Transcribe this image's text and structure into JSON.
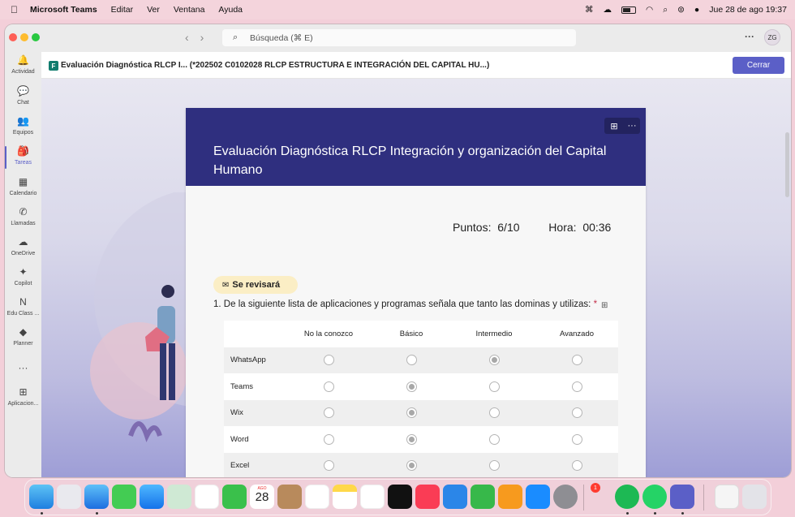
{
  "menubar": {
    "app_name": "Microsoft Teams",
    "menus": [
      "Editar",
      "Ver",
      "Ventana",
      "Ayuda"
    ],
    "datetime": "Jue 28 de ago  19:37"
  },
  "titlebar": {
    "search_placeholder": "Búsqueda (⌘ E)",
    "more": "···",
    "avatar_initials": "ZG"
  },
  "rail": {
    "items": [
      {
        "label": "Actividad",
        "icon": "bell-icon",
        "glyph": "🔔"
      },
      {
        "label": "Chat",
        "icon": "chat-icon",
        "glyph": "💬"
      },
      {
        "label": "Equipos",
        "icon": "teams-icon",
        "glyph": "👥"
      },
      {
        "label": "Tareas",
        "icon": "tasks-icon",
        "glyph": "🎒"
      },
      {
        "label": "Calendario",
        "icon": "calendar-icon",
        "glyph": "▦"
      },
      {
        "label": "Llamadas",
        "icon": "phone-icon",
        "glyph": "✆"
      },
      {
        "label": "OneDrive",
        "icon": "cloud-icon",
        "glyph": "☁"
      },
      {
        "label": "Copilot",
        "icon": "copilot-icon",
        "glyph": "✦"
      },
      {
        "label": "Edu Class ...",
        "icon": "notebook-icon",
        "glyph": "N"
      },
      {
        "label": "Planner",
        "icon": "planner-icon",
        "glyph": "◆"
      },
      {
        "label": "",
        "icon": "more-icon",
        "glyph": "···"
      },
      {
        "label": "Aplicacion...",
        "icon": "add-apps-icon",
        "glyph": "⊞"
      }
    ],
    "active_index": 3
  },
  "header": {
    "file_icon": "excel-forms-icon",
    "title": "Evaluación Diagnóstica RLCP  I... (*202502 C0102028 RLCP ESTRUCTURA E INTEGRACIÓN DEL CAPITAL HU...)",
    "close_label": "Cerrar"
  },
  "form": {
    "title": "Evaluación Diagnóstica RLCP  Integración y organización del Capital Humano",
    "points_label": "Puntos:",
    "points_value": "6/10",
    "time_label": "Hora:",
    "time_value": "00:36",
    "review_badge": "Se revisará",
    "question_number": "1.",
    "question_text": "De la siguiente lista de aplicaciones y programas señala que tanto las dominas y utilizas:",
    "required_mark": "*",
    "columns": [
      "No la conozco",
      "Básico",
      "Intermedio",
      "Avanzado"
    ],
    "rows": [
      {
        "label": "WhatsApp",
        "selected": 2
      },
      {
        "label": "Teams",
        "selected": 1
      },
      {
        "label": "Wix",
        "selected": 1
      },
      {
        "label": "Word",
        "selected": 1
      },
      {
        "label": "Excel",
        "selected": 1
      }
    ]
  },
  "dock": {
    "calendar_month": "AGO",
    "calendar_day": "28",
    "settings_badge": "1"
  }
}
